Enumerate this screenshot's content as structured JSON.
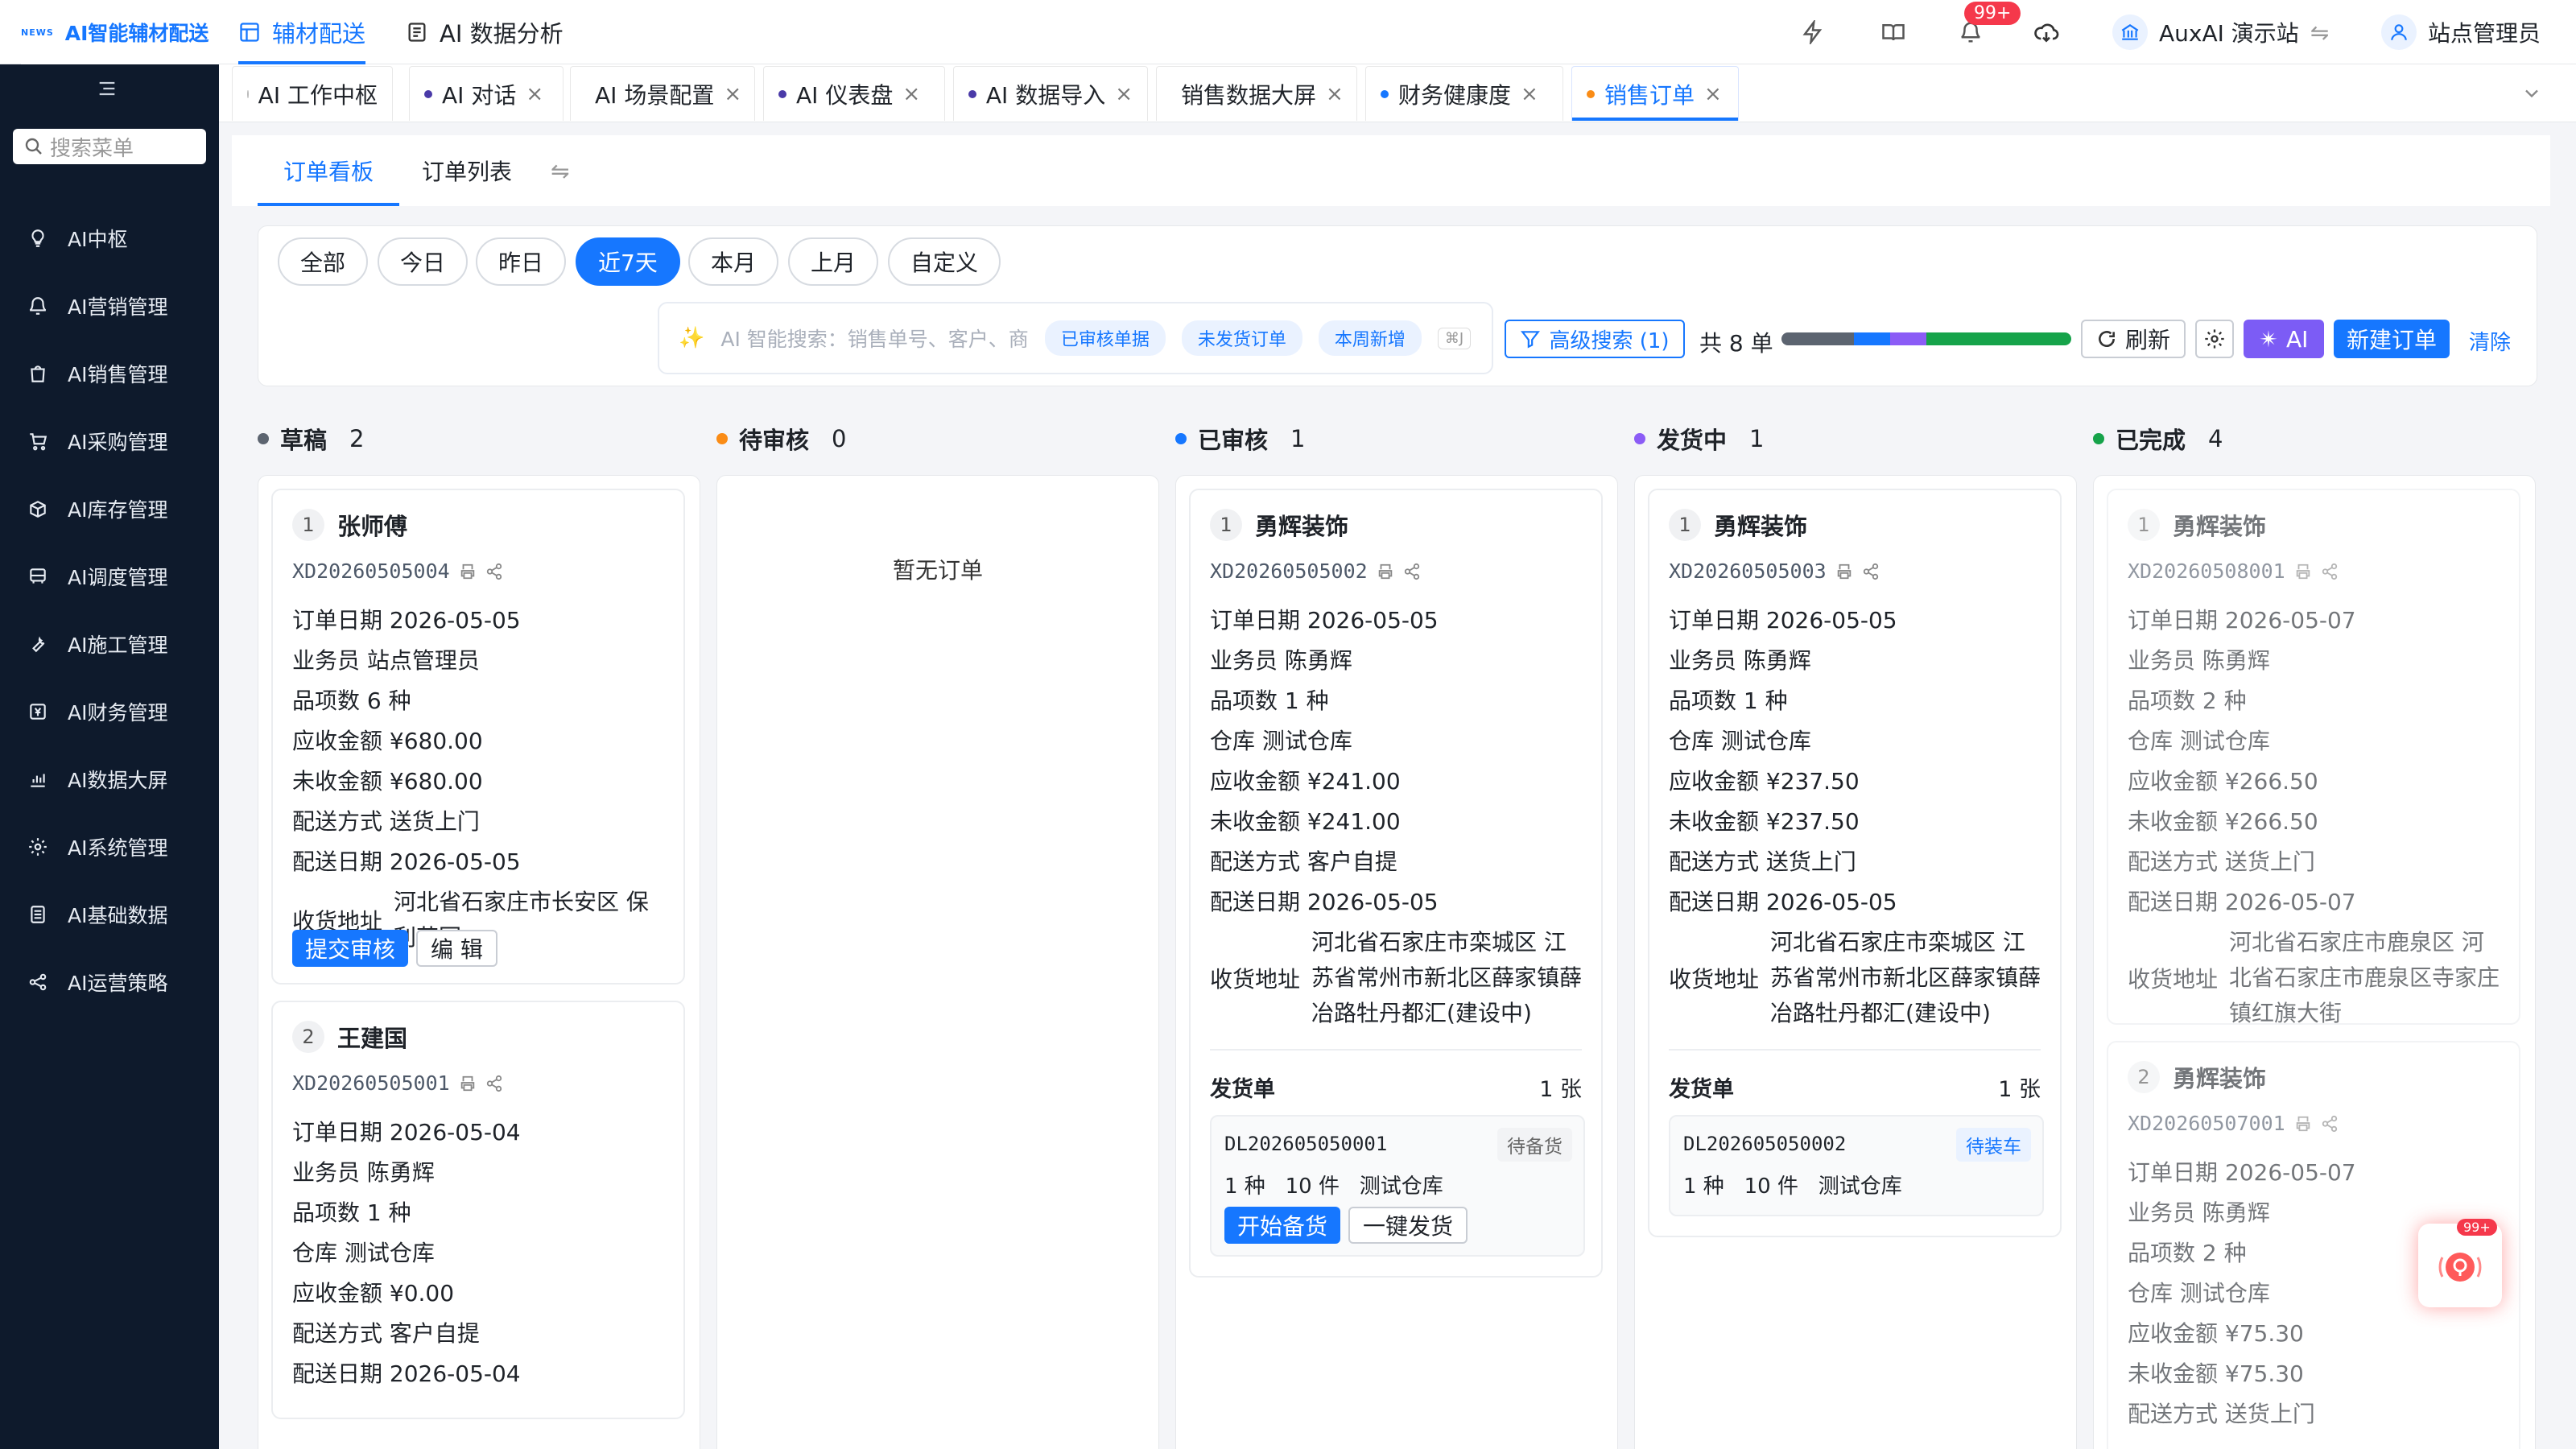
{
  "brand": {
    "logo": "NEWS",
    "name": "AI智能辅材配送"
  },
  "topnav": [
    {
      "label": "辅材配送"
    },
    {
      "label": "AI 数据分析"
    }
  ],
  "top": {
    "notif_badge": "99+",
    "station": "AuxAI 演示站",
    "user": "站点管理员"
  },
  "sidebar": {
    "search_placeholder": "搜索菜单",
    "items": [
      {
        "label": "AI中枢",
        "icon": "bulb-icon"
      },
      {
        "label": "AI营销管理",
        "icon": "bell-icon"
      },
      {
        "label": "AI销售管理",
        "icon": "bag-icon"
      },
      {
        "label": "AI采购管理",
        "icon": "cart-icon"
      },
      {
        "label": "AI库存管理",
        "icon": "box-icon"
      },
      {
        "label": "AI调度管理",
        "icon": "bus-icon"
      },
      {
        "label": "AI施工管理",
        "icon": "wrench-icon"
      },
      {
        "label": "AI财务管理",
        "icon": "finance-icon"
      },
      {
        "label": "AI数据大屏",
        "icon": "chart-icon"
      },
      {
        "label": "AI系统管理",
        "icon": "gear-icon"
      },
      {
        "label": "AI基础数据",
        "icon": "doc-icon"
      },
      {
        "label": "AI运营策略",
        "icon": "network-icon"
      }
    ]
  },
  "pagetabs": [
    {
      "label": "AI 工作中枢"
    },
    {
      "label": "AI 对话"
    },
    {
      "label": "AI 场景配置"
    },
    {
      "label": "AI 仪表盘"
    },
    {
      "label": "AI 数据导入"
    },
    {
      "label": "销售数据大屏"
    },
    {
      "label": "财务健康度"
    },
    {
      "label": "销售订单"
    }
  ],
  "subtabs": [
    {
      "label": "订单看板"
    },
    {
      "label": "订单列表"
    }
  ],
  "filter": {
    "periods": [
      {
        "label": "全部"
      },
      {
        "label": "今日"
      },
      {
        "label": "昨日"
      },
      {
        "label": "近7天"
      },
      {
        "label": "本月"
      },
      {
        "label": "上月"
      },
      {
        "label": "自定义"
      }
    ],
    "ai_placeholder": "AI 智能搜索：销售单号、客户、商",
    "chips": [
      {
        "label": "已审核单据"
      },
      {
        "label": "未发货订单"
      },
      {
        "label": "本周新增"
      }
    ],
    "kbd": "⌘J",
    "adv": "高级搜索 (1)",
    "total": "共 8 单",
    "refresh": "刷新",
    "ai": "AI",
    "new": "新建订单",
    "clear": "清除"
  },
  "colors": {
    "primary": "#1677ff",
    "draft": "#5c6470",
    "pending": "#fa8c16",
    "approved": "#1677ff",
    "shipping": "#8b5cf6",
    "done": "#16a34a"
  },
  "status_bar": [
    {
      "status": "草稿",
      "count": 2
    },
    {
      "status": "已审核",
      "count": 1
    },
    {
      "status": "发货中",
      "count": 1
    },
    {
      "status": "已完成",
      "count": 4
    }
  ],
  "columns": [
    {
      "title": "草稿",
      "count": "2",
      "empty": "",
      "cards": [
        {
          "idx": "1",
          "name": "张师傅",
          "no": "XD20260505004",
          "rows": [
            "订单日期 2026-05-05",
            "业务员 站点管理员",
            "品项数 6 种",
            "应收金额 ¥680.00",
            "未收金额 ¥680.00",
            "配送方式 送货上门",
            "配送日期 2026-05-05"
          ],
          "addr_label": "收货地址",
          "addr": "河北省石家庄市长安区 保利花园",
          "btn1": "提交审核",
          "btn2": "编 辑"
        },
        {
          "idx": "2",
          "name": "王建国",
          "no": "XD20260505001",
          "rows": [
            "订单日期 2026-05-04",
            "业务员 陈勇辉",
            "品项数 1 种",
            "仓库 测试仓库",
            "应收金额 ¥0.00",
            "配送方式 客户自提",
            "配送日期 2026-05-04"
          ]
        }
      ]
    },
    {
      "title": "待审核",
      "count": "0",
      "empty": "暂无订单",
      "cards": []
    },
    {
      "title": "已审核",
      "count": "1",
      "cards": [
        {
          "idx": "1",
          "name": "勇辉装饰",
          "no": "XD20260505002",
          "rows": [
            "订单日期 2026-05-05",
            "业务员 陈勇辉",
            "品项数 1 种",
            "仓库 测试仓库",
            "应收金额 ¥241.00",
            "未收金额 ¥241.00",
            "配送方式 客户自提",
            "配送日期 2026-05-05"
          ],
          "addr_label": "收货地址",
          "addr": "河北省石家庄市栾城区 江苏省常州市新北区薛家镇薛冶路牡丹都汇(建设中)",
          "ship_label": "发货单",
          "ship_count": "1 张",
          "dl_no": "DL202605050001",
          "dl_status": "待备货",
          "dl_info": "1 种   10 件   测试仓库",
          "btn1": "开始备货",
          "btn2": "一键发货"
        }
      ]
    },
    {
      "title": "发货中",
      "count": "1",
      "cards": [
        {
          "idx": "1",
          "name": "勇辉装饰",
          "no": "XD20260505003",
          "rows": [
            "订单日期 2026-05-05",
            "业务员 陈勇辉",
            "品项数 1 种",
            "仓库 测试仓库",
            "应收金额 ¥237.50",
            "未收金额 ¥237.50",
            "配送方式 送货上门",
            "配送日期 2026-05-05"
          ],
          "addr_label": "收货地址",
          "addr": "河北省石家庄市栾城区 江苏省常州市新北区薛家镇薛冶路牡丹都汇(建设中)",
          "ship_label": "发货单",
          "ship_count": "1 张",
          "dl_no": "DL202605050002",
          "dl_status": "待装车",
          "dl_info": "1 种   10 件   测试仓库"
        }
      ]
    },
    {
      "title": "已完成",
      "count": "4",
      "cards": [
        {
          "idx": "1",
          "name": "勇辉装饰",
          "no": "XD20260508001",
          "rows": [
            "订单日期 2026-05-07",
            "业务员 陈勇辉",
            "品项数 2 种",
            "仓库 测试仓库",
            "应收金额 ¥266.50",
            "未收金额 ¥266.50",
            "配送方式 送货上门",
            "配送日期 2026-05-07"
          ],
          "addr_label": "收货地址",
          "addr": "河北省石家庄市鹿泉区 河北省石家庄市鹿泉区寺家庄镇红旗大街"
        },
        {
          "idx": "2",
          "name": "勇辉装饰",
          "no": "XD20260507001",
          "rows": [
            "订单日期 2026-05-07",
            "业务员 陈勇辉",
            "品项数 2 种",
            "仓库 测试仓库",
            "应收金额 ¥75.30",
            "未收金额 ¥75.30",
            "配送方式 送货上门"
          ]
        }
      ]
    }
  ],
  "float_badge": "99+"
}
